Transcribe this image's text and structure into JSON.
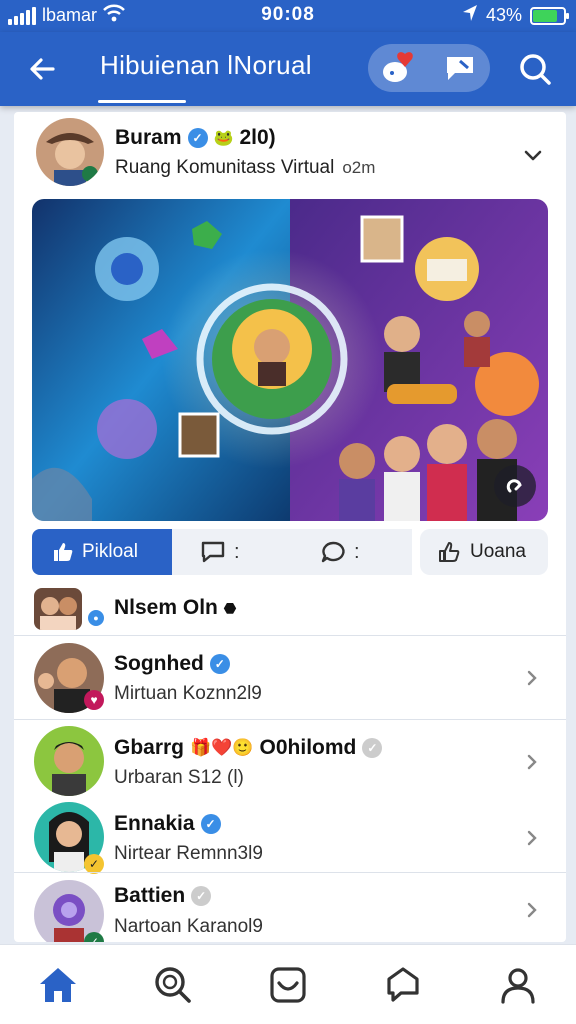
{
  "status_bar": {
    "carrier": "lbamar",
    "time": "90:08",
    "battery": "43%",
    "battery_level": 0.75
  },
  "header": {
    "title": "Hibuienan lNorual",
    "back_icon": "arrow-left-icon",
    "pill_icons": [
      "heart-notification-icon",
      "chat-bubble-icon"
    ],
    "search_icon": "search-icon"
  },
  "post": {
    "author": "Buram",
    "author_extra": "2l0)",
    "group": "Ruang Komunitass Virtual",
    "time": "o2m",
    "menu_icon": "chevron-down-icon"
  },
  "actions": {
    "like": "Pikloal",
    "comment": ":",
    "reply": ":",
    "share": "Uoana"
  },
  "members": [
    {
      "name": "Nlsem Oln",
      "subtitle": ""
    },
    {
      "name": "Sognhed",
      "subtitle": "Mirtuan Koznn2l9"
    },
    {
      "name": "Gbarrg",
      "name_extra": "O0hilomd",
      "subtitle": "Urbaran S12 (l)"
    },
    {
      "name": "Ennakia",
      "subtitle": "Nirtear Remnn3l9"
    },
    {
      "name": "Battien",
      "subtitle": "Nartoan Karanol9"
    }
  ],
  "bottom_nav": [
    "home-icon",
    "explore-icon",
    "inbox-icon",
    "messages-icon",
    "profile-icon"
  ],
  "colors": {
    "primary": "#2a62c6",
    "verified": "#3a8ee6",
    "battery": "#3ed35a",
    "notification": "#e53935"
  }
}
